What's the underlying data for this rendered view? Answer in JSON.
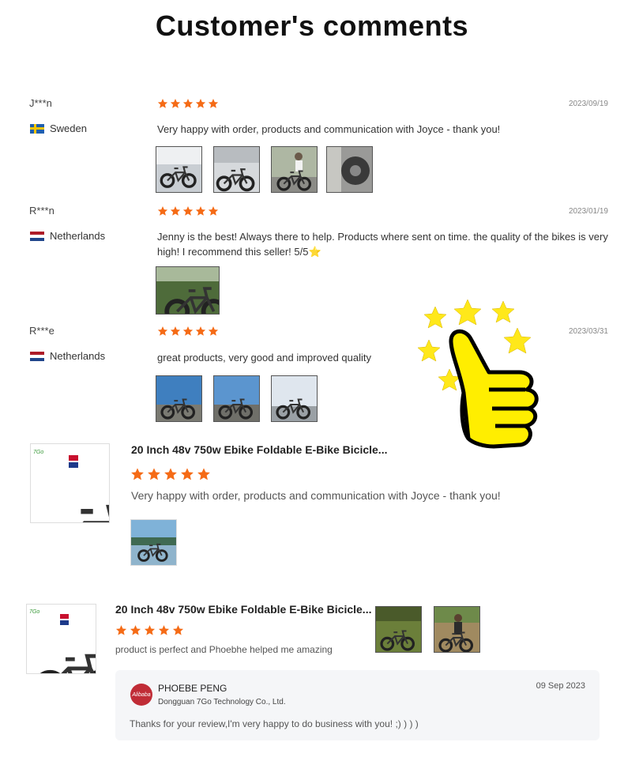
{
  "page_title": "Customer's comments",
  "icons": {
    "star": "star-icon",
    "thumbs_up": "thumbs-up-icon",
    "flag_sweden": "flag-sweden-icon",
    "flag_netherlands": "flag-netherlands-icon"
  },
  "colors": {
    "star": "#f56b16",
    "thumb_yellow": "#ffee00",
    "sparkle_yellow": "#ffe81a"
  },
  "reviews": [
    {
      "user": "J***n",
      "date": "2023/09/19",
      "country": "Sweden",
      "rating": 5,
      "comment": "Very happy with order, products and communication with Joyce - thank you!",
      "photo_count": 4
    },
    {
      "user": "R***n",
      "date": "2023/01/19",
      "country": "Netherlands",
      "rating": 5,
      "comment_line1": "Jenny is the best! Always there to help. Products where sent on time. the quality of the bikes is very",
      "comment_line2": "high! I recommend this seller! 5/5",
      "comment_emoji": "⭐",
      "photo_count": 1
    },
    {
      "user": "R***e",
      "date": "2023/03/31",
      "country": "Netherlands",
      "rating": 5,
      "comment": "great products, very good and improved quality",
      "photo_count": 3
    }
  ],
  "product_reviews": [
    {
      "product_title": "20 Inch 48v 750w Ebike Foldable E-Bike Bicicle...",
      "rating": 5,
      "comment": "Very happy with order, products and communication with Joyce - thank you!",
      "brand_mark": "7Go"
    },
    {
      "product_title": "20 Inch 48v 750w Ebike Foldable E-Bike Bicicle...",
      "rating": 5,
      "comment": "product is perfect and Phoebhe helped me amazing",
      "brand_mark": "7Go",
      "reply": {
        "name": "PHOEBE PENG",
        "company": "Dongguan 7Go Technology Co., Ltd.",
        "date": "09 Sep 2023",
        "text": "Thanks for your review,I'm very happy to do business with you! ;)  )  )  )",
        "avatar_text": "Alibaba"
      }
    }
  ]
}
